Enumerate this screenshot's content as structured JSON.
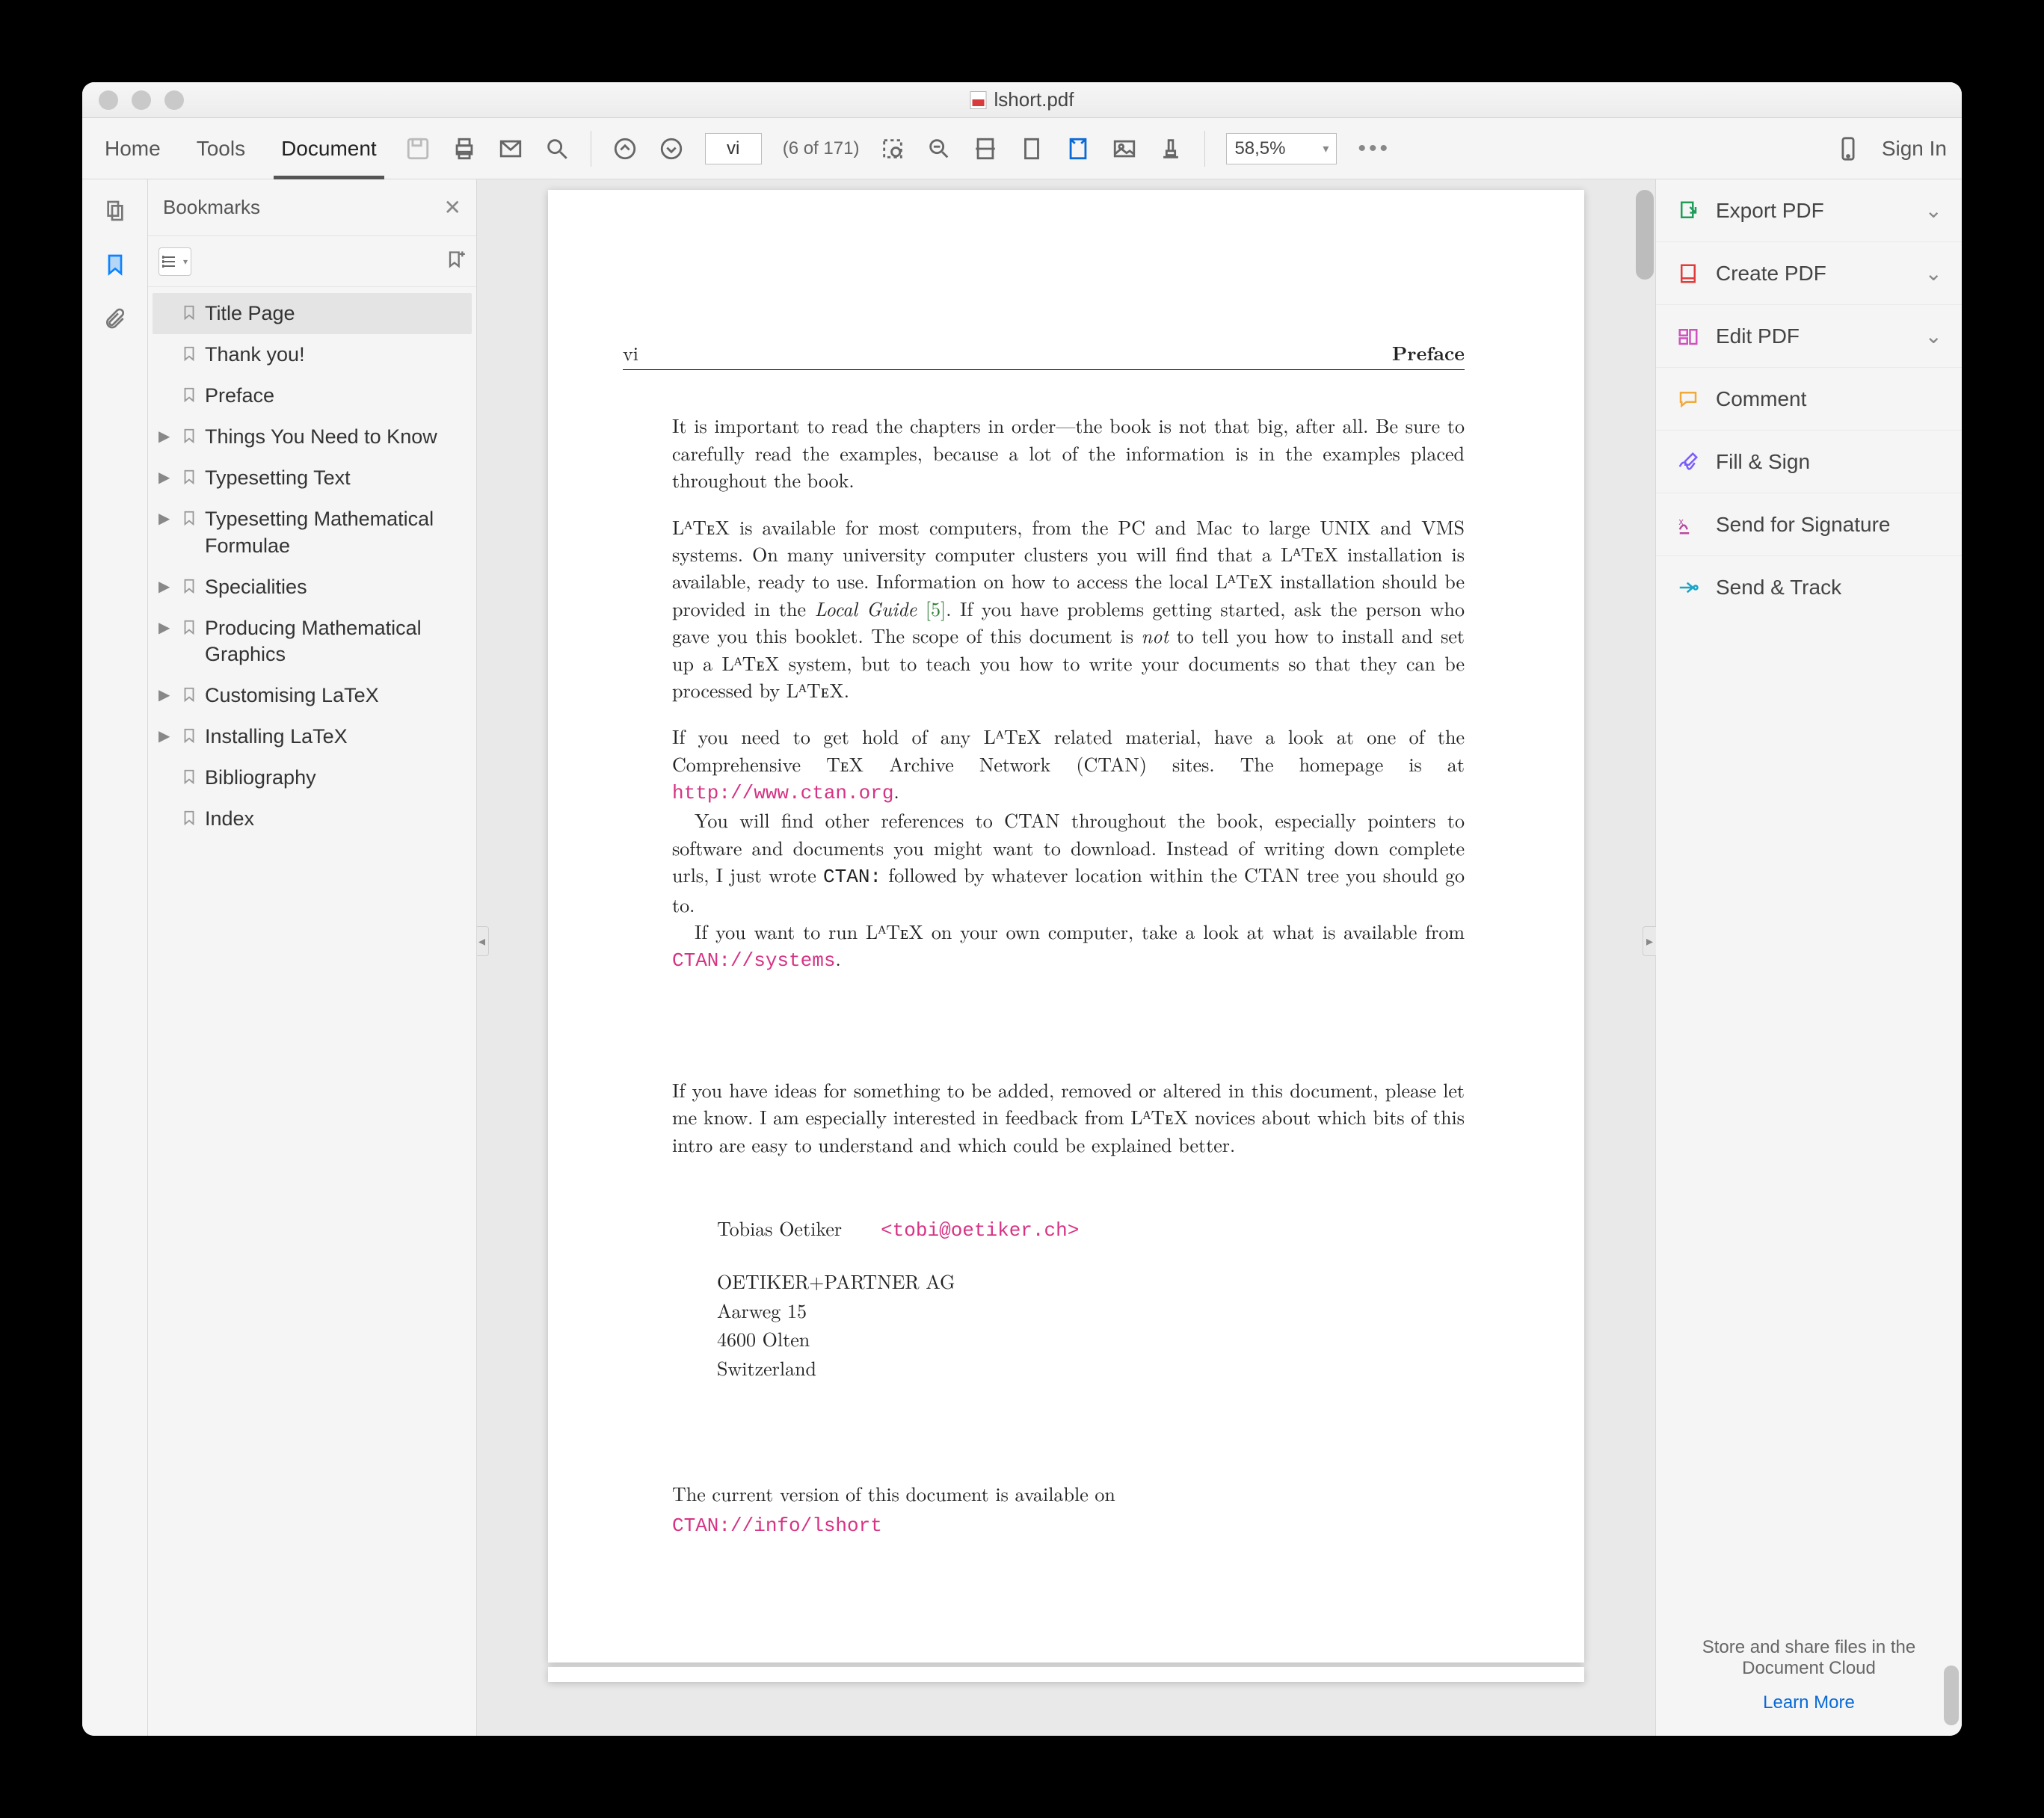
{
  "window": {
    "title": "lshort.pdf"
  },
  "tabs": {
    "home": "Home",
    "tools": "Tools",
    "document": "Document"
  },
  "toolbar": {
    "page_value": "vi",
    "page_of": "(6 of 171)",
    "zoom": "58,5%",
    "signin": "Sign In"
  },
  "bookmarks": {
    "title": "Bookmarks",
    "items": [
      {
        "label": "Title Page",
        "selected": true,
        "expandable": false
      },
      {
        "label": "Thank you!",
        "expandable": false
      },
      {
        "label": "Preface",
        "expandable": false
      },
      {
        "label": "Things You Need to Know",
        "expandable": true
      },
      {
        "label": "Typesetting Text",
        "expandable": true
      },
      {
        "label": "Typesetting Mathematical Formulae",
        "expandable": true
      },
      {
        "label": "Specialities",
        "expandable": true
      },
      {
        "label": "Producing Mathematical Graphics",
        "expandable": true
      },
      {
        "label": "Customising LaTeX",
        "expandable": true
      },
      {
        "label": "Installing LaTeX",
        "expandable": true
      },
      {
        "label": "Bibliography",
        "expandable": false
      },
      {
        "label": "Index",
        "expandable": false
      }
    ]
  },
  "rightpane": {
    "items": [
      {
        "label": "Export PDF",
        "chev": true,
        "color": "#1e9e5a"
      },
      {
        "label": "Create PDF",
        "chev": true,
        "color": "#e23b3b"
      },
      {
        "label": "Edit PDF",
        "chev": true,
        "color": "#d052c0"
      },
      {
        "label": "Comment",
        "chev": false,
        "color": "#f2a93b"
      },
      {
        "label": "Fill & Sign",
        "chev": false,
        "color": "#7a5cff"
      },
      {
        "label": "Send for Signature",
        "chev": false,
        "color": "#b84a9e"
      },
      {
        "label": "Send & Track",
        "chev": false,
        "color": "#1aa3c7"
      }
    ],
    "cloud_line1": "Store and share files in the",
    "cloud_line2": "Document Cloud",
    "learn_more": "Learn More"
  },
  "doc": {
    "run_left": "vi",
    "run_right": "Preface",
    "p1": "It is important to read the chapters in order—the book is not that big, after all. Be sure to carefully read the examples, because a lot of the information is in the examples placed throughout the book.",
    "p2a": "LᴬTᴇX is available for most computers, from the PC and Mac to large UNIX and VMS systems. On many university computer clusters you will find that a LᴬTᴇX installation is available, ready to use. Information on how to access the local LᴬTᴇX installation should be provided in the ",
    "p2_local": "Local Guide",
    "p2_cite": " [5]",
    "p2b": ". If you have problems getting started, ask the person who gave you this booklet. The scope of this document is ",
    "p2_not": "not",
    "p2c": " to tell you how to install and set up a LᴬTᴇX system, but to teach you how to write your documents so that they can be processed by LᴬTᴇX.",
    "p3a": "If you need to get hold of any LᴬTᴇX related material, have a look at one of the Comprehensive TᴇX Archive Network (CTAN) sites. The homepage is at ",
    "p3_url": "http://www.ctan.org",
    "p3b": ".",
    "p4a": "You will find other references to CTAN throughout the book, especially pointers to software and documents you might want to download. Instead of writing down complete urls, I just wrote ",
    "p4_ctan": "CTAN:",
    "p4b": " followed by whatever location within the CTAN tree you should go to.",
    "p5a": "If you want to run LᴬTᴇX on your own computer, take a look at what is available from ",
    "p5_url": "CTAN://systems",
    "p5b": ".",
    "p6": "If you have ideas for something to be added, removed or altered in this document, please let me know. I am especially interested in feedback from LᴬTᴇX novices about which bits of this intro are easy to understand and which could be explained better.",
    "author": "Tobias Oetiker",
    "email": "<tobi@oetiker.ch>",
    "addr1": "OETIKER+PARTNER AG",
    "addr2": "Aarweg 15",
    "addr3": "4600 Olten",
    "addr4": "Switzerland",
    "avail": "The current version of this document is available on",
    "avail_url": "CTAN://info/lshort"
  }
}
